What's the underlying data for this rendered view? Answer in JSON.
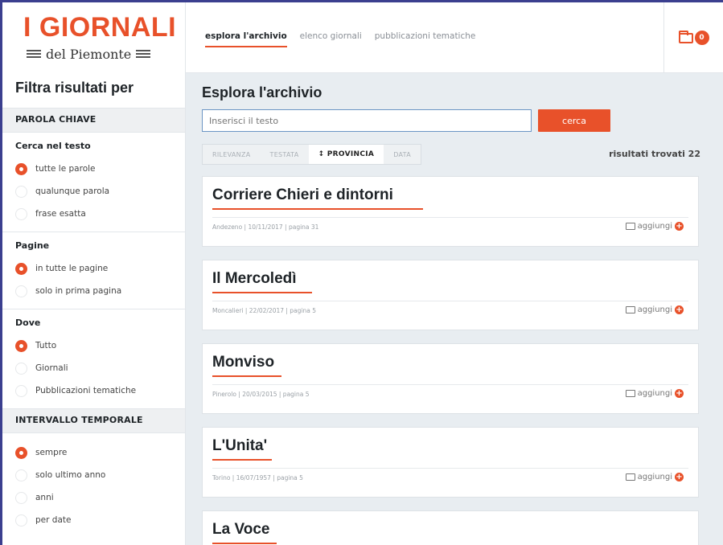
{
  "logo": {
    "title": "I GIORNALI",
    "subtitle": "del Piemonte"
  },
  "nav": {
    "items": [
      "esplora l'archivio",
      "elenco giornali",
      "pubblicazioni tematiche"
    ],
    "active_index": 0
  },
  "cart": {
    "count": "0",
    "icon": "folder-icon"
  },
  "sidebar": {
    "title": "Filtra risultati per",
    "keyword_section": "PAROLA CHIAVE",
    "search_in_text": {
      "title": "Cerca nel testo",
      "options": [
        "tutte le parole",
        "qualunque parola",
        "frase esatta"
      ],
      "selected": 0
    },
    "pages": {
      "title": "Pagine",
      "options": [
        "in tutte le pagine",
        "solo in prima pagina"
      ],
      "selected": 0
    },
    "where": {
      "title": "Dove",
      "options": [
        "Tutto",
        "Giornali",
        "Pubblicazioni tematiche"
      ],
      "selected": 0
    },
    "time_section": "INTERVALLO TEMPORALE",
    "time": {
      "options": [
        "sempre",
        "solo ultimo anno",
        "anni",
        "per date"
      ],
      "selected": 0
    }
  },
  "main": {
    "title": "Esplora l'archivio",
    "search": {
      "placeholder": "Inserisci il testo",
      "button": "cerca"
    },
    "sort": {
      "options": [
        "RILEVANZA",
        "TESTATA",
        "↕ PROVINCIA",
        "DATA"
      ],
      "active_index": 2
    },
    "results_label": "risultati trovati 22",
    "add_label": "aggiungi",
    "results": [
      {
        "title": "Corriere Chieri e dintorni",
        "meta": "Andezeno | 10/11/2017 | pagina 31"
      },
      {
        "title": "Il Mercoledì",
        "meta": "Moncalieri | 22/02/2017 | pagina 5"
      },
      {
        "title": "Monviso",
        "meta": "Pinerolo | 20/03/2015 | pagina 5"
      },
      {
        "title": "L'Unita'",
        "meta": "Torino | 16/07/1957 | pagina 5"
      },
      {
        "title": "La Voce",
        "meta": ""
      }
    ]
  },
  "colors": {
    "accent": "#e8512a",
    "background": "#e8edf1",
    "frame": "#3b3f8f"
  }
}
